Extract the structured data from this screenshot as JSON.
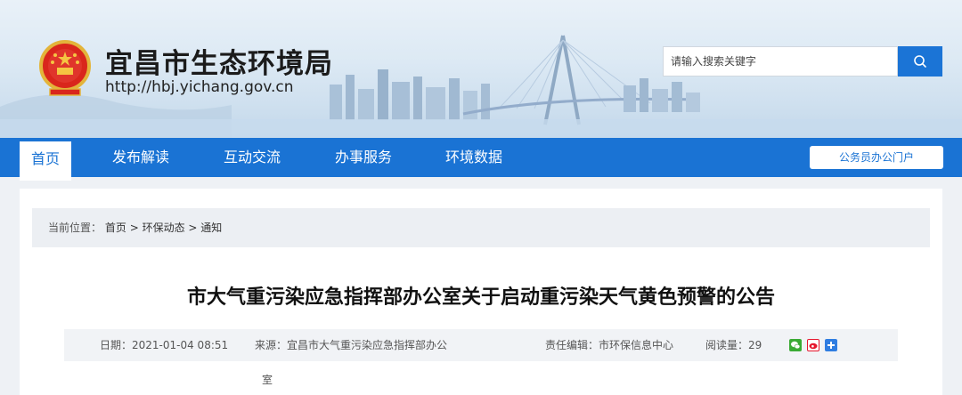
{
  "header": {
    "site_title": "宜昌市生态环境局",
    "site_url": "http://hbj.yichang.gov.cn",
    "emblem_icon": "national-emblem-icon"
  },
  "search": {
    "placeholder": "请输入搜索关键字",
    "button_icon": "search-icon"
  },
  "nav": {
    "items": [
      {
        "label": "首页",
        "active": true
      },
      {
        "label": "发布解读"
      },
      {
        "label": "互动交流"
      },
      {
        "label": "办事服务"
      },
      {
        "label": "环境数据"
      }
    ],
    "portal_button": "公务员办公门户"
  },
  "breadcrumb": {
    "prefix": "当前位置：",
    "items": [
      "首页",
      "环保动态",
      "通知"
    ],
    "separator": ">"
  },
  "article": {
    "title": "市大气重污染应急指挥部办公室关于启动重污染天气黄色预警的公告",
    "date": "日期：2021-01-04 08:51",
    "source_line1": "来源：宜昌市大气重污染应急指挥部办公",
    "source_line2": "室",
    "editor": "责任编辑：市环保信息中心",
    "reads": "阅读量：29"
  },
  "share": {
    "icons": [
      "wechat-share-icon",
      "weibo-share-icon",
      "more-share-icon"
    ]
  },
  "colors": {
    "primary": "#1a73d4",
    "wechat": "#3aaa35",
    "weibo": "#e6162d",
    "more": "#2f7de1"
  }
}
